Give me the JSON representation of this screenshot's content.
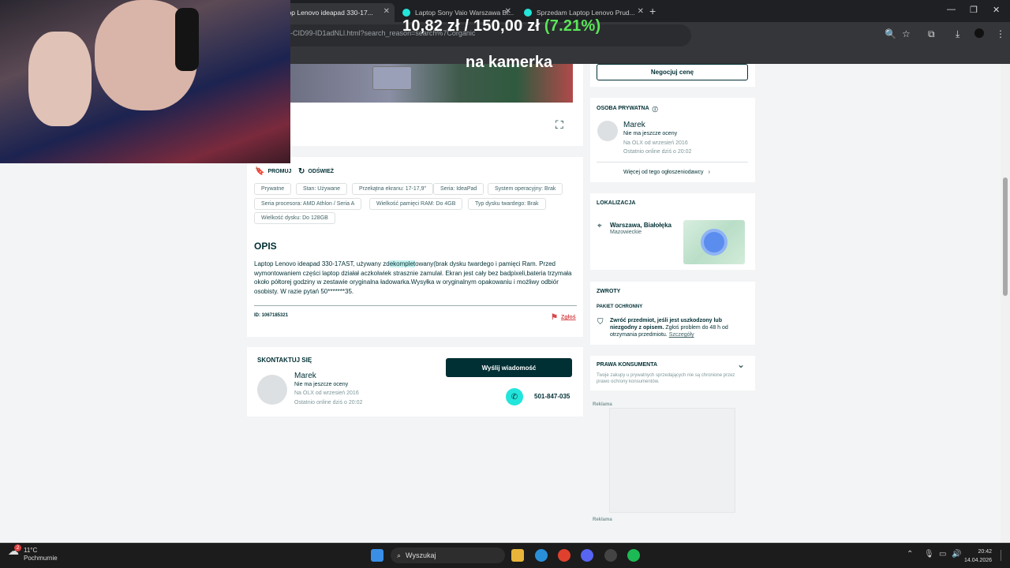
{
  "browser": {
    "tabs": [
      {
        "label": "Laptop Lenovo ideapad 330-17...",
        "active": true
      },
      {
        "label": "Laptop Sony Vaio Warszawa Bi...",
        "active": false
      },
      {
        "label": "Sprzedam Laptop Lenovo Prud...",
        "active": false
      }
    ],
    "new_tab_label": "+",
    "url_fragment": "-CID99-ID1adNLl.html?search_reason=search%7Corganic",
    "window_controls": [
      "—",
      "❐",
      "✕"
    ]
  },
  "overlay": {
    "price_text": "10,82 zł / 150,00 zł",
    "percent_text": "(7.21%)",
    "photo_caption": "na kamerka"
  },
  "ad": {
    "promote_label": "PROMUJ",
    "refresh_label": "ODŚWIEŻ",
    "params": [
      [
        "Prywatne",
        "Stan: Używane",
        "Przekątna ekranu: 17-17,9\"",
        "Seria: IdeaPad",
        "System operacyjny: Brak"
      ],
      [
        "Seria procesora: AMD Athlon / Seria A",
        "Wielkość pamięci RAM: Do 4GB",
        "Typ dysku twardego: Brak"
      ],
      [
        "Wielkość dysku: Do 128GB"
      ]
    ],
    "description_heading": "OPIS",
    "description_before": "Laptop Lenovo ideapad 330-17AST, używany zd",
    "description_highlight": "ekomplet",
    "description_after": "owany(brak dysku twardego i pamięci Ram. Przed wymontowaniem części laptop działał aczkolwiek strasznie zamulał. Ekran jest cały bez badpixeli,bateria trzymała około półtorej godziny w zestawie oryginalna ładowarka.Wysyłka w oryginalnym opakowaniu i możliwy odbiór osobisty. W razie pytań 50*******35.",
    "id_label": "ID: 1067185321",
    "report_label": "Zgłoś"
  },
  "contact": {
    "heading": "SKONTAKTUJ SIĘ",
    "name": "Marek",
    "rating": "Nie ma jeszcze oceny",
    "since": "Na OLX od wrzesień 2016",
    "online": "Ostatnio online dziś o 20:02",
    "message_button": "Wyślij wiadomość",
    "phone": "501-847-035"
  },
  "sidebar": {
    "negotiate_button": "Negocjuj cenę",
    "seller_heading": "OSOBA PRYWATNA",
    "seller_name": "Marek",
    "seller_rating": "Nie ma jeszcze oceny",
    "seller_since": "Na OLX od wrzesień 2016",
    "seller_online": "Ostatnio online dziś o 20:02",
    "more_link": "Więcej od tego ogłoszeniodawcy",
    "location_heading": "LOKALIZACJA",
    "location_city": "Warszawa, Białołęka",
    "location_region": "Mazowieckie",
    "returns_heading": "ZWROTY",
    "package_label": "PAKIET OCHRONNY",
    "returns_bold": "Zwróć przedmiot, jeśli jest uszkodzony lub niezgodny z opisem.",
    "returns_text": " Zgłoś problem do 48 h od otrzymania przedmiotu.",
    "returns_link": "Szczegóły",
    "consumer_heading": "PRAWA KONSUMENTA",
    "consumer_text": "Twoje zakupy u prywatnych sprzedających nie są chronione przez prawo ochrony konsumentów.",
    "ad_label_top": "Reklama",
    "ad_label_bottom": "Reklama"
  },
  "taskbar": {
    "temp": "11°C",
    "weather": "Pochmurnie",
    "weather_badge": "2",
    "search_label": "Wyszukaj",
    "time": "20:42",
    "date": "14.04.2026"
  },
  "colors": {
    "olx_dark": "#002f34",
    "olx_teal": "#23e5db",
    "report_red": "#d7474b"
  }
}
